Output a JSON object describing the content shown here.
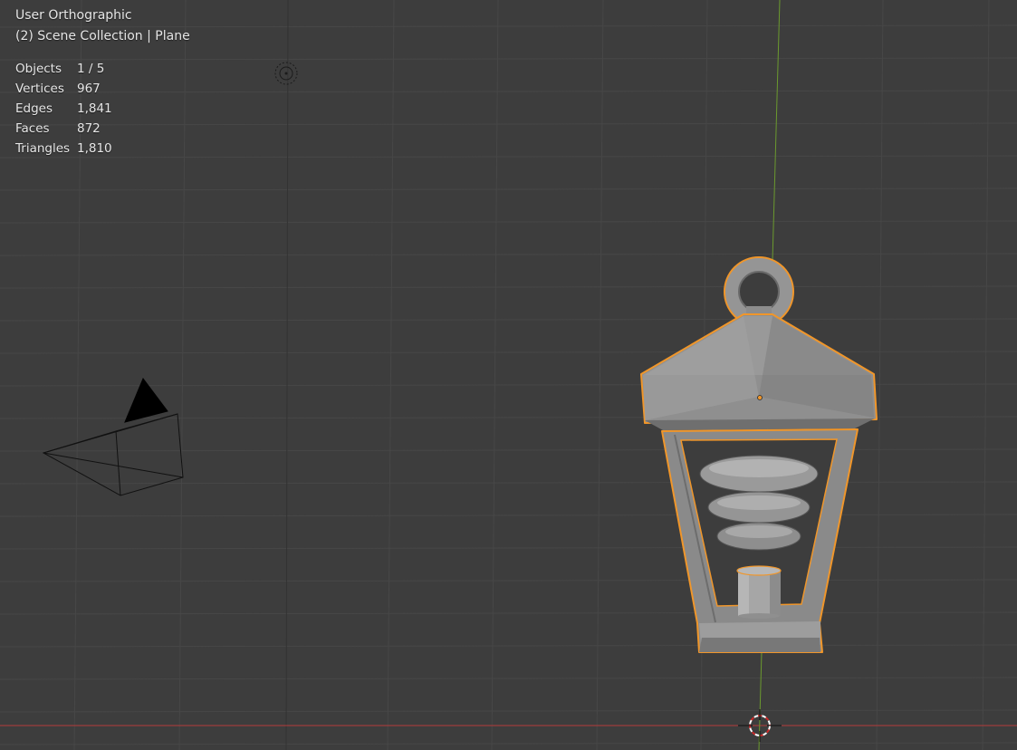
{
  "viewport": {
    "view_name": "User Orthographic",
    "collection_info": "(2) Scene Collection | Plane",
    "stats": [
      {
        "label": "Objects",
        "value": "1 / 5"
      },
      {
        "label": "Vertices",
        "value": "967"
      },
      {
        "label": "Edges",
        "value": "1,841"
      },
      {
        "label": "Faces",
        "value": "872"
      },
      {
        "label": "Triangles",
        "value": "1,810"
      }
    ]
  },
  "colors": {
    "background": "#3d3d3d",
    "grid": "#4a4a4a",
    "x_axis": "#b53a3a",
    "y_axis": "#6b9a2e",
    "selection_outline": "#f0962a",
    "mesh": "#9a9a9a"
  },
  "icons": [
    "light-icon",
    "camera-icon",
    "3d-cursor-icon"
  ]
}
